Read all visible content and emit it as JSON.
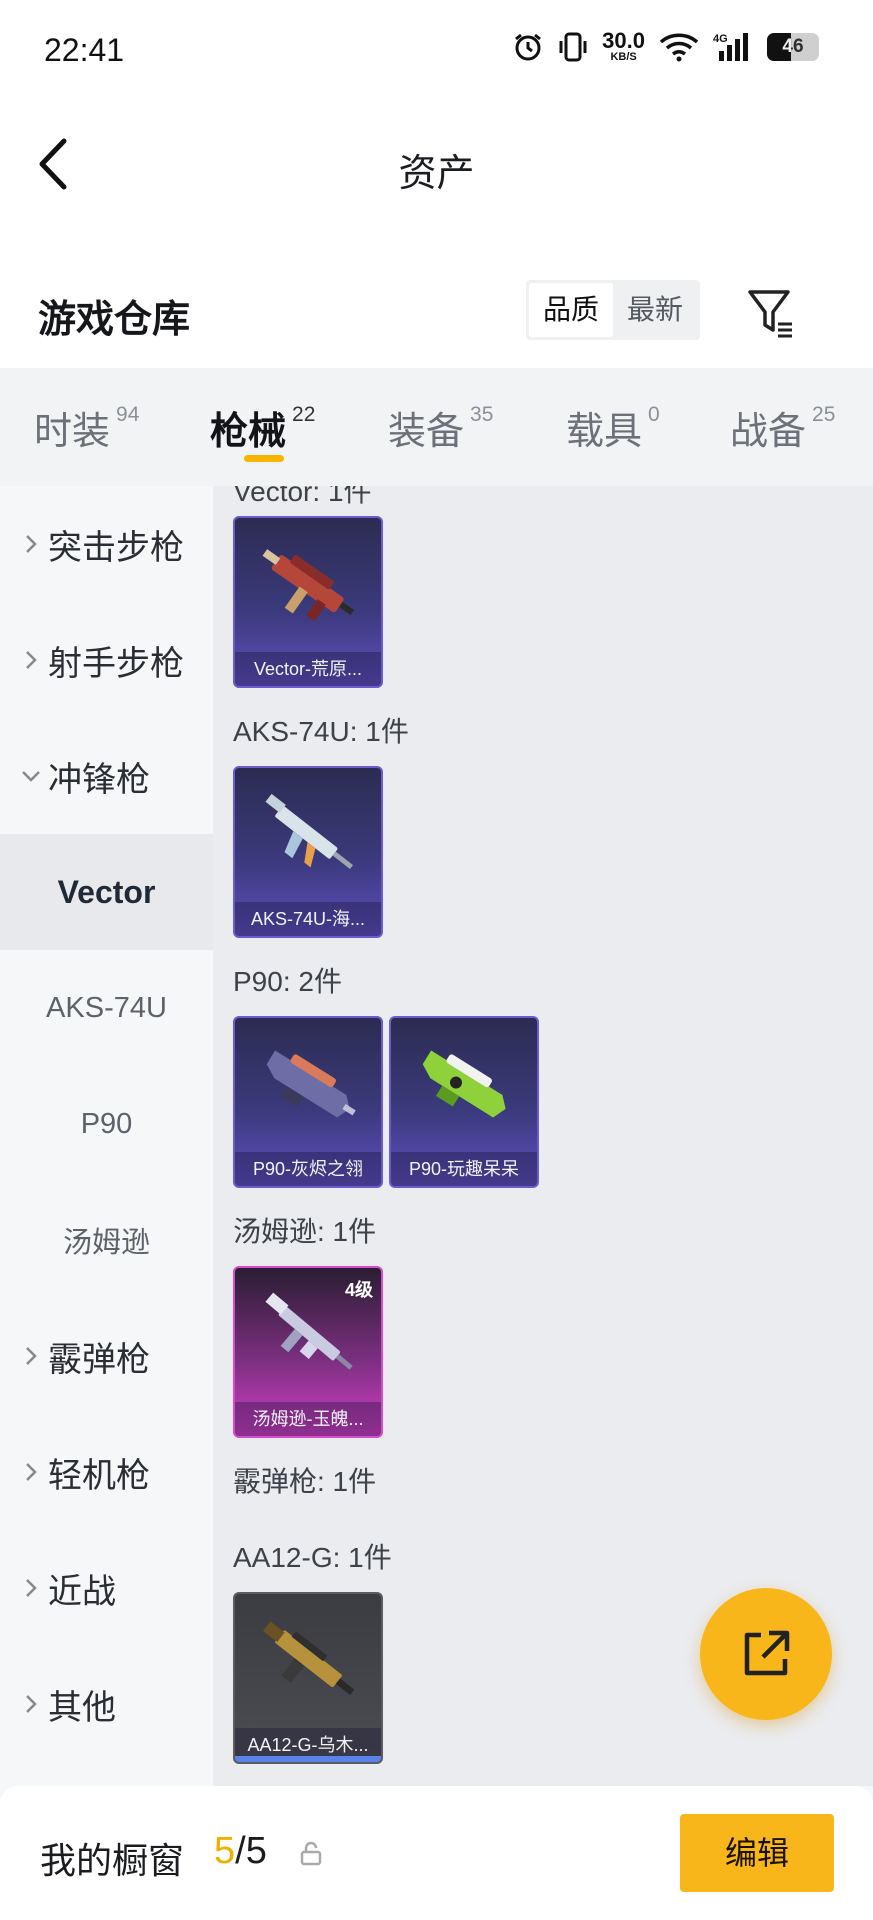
{
  "status_bar": {
    "time": "22:41",
    "net_speed_value": "30.0",
    "net_speed_unit": "KB/S",
    "network_type": "4G",
    "battery_level": "46",
    "icons": [
      "alarm-icon",
      "vibrate-icon",
      "wifi-icon",
      "signal-icon",
      "battery-icon"
    ]
  },
  "header": {
    "title": "资产"
  },
  "section": {
    "title": "游戏仓库",
    "sort_options": [
      {
        "label": "品质",
        "active": true
      },
      {
        "label": "最新",
        "active": false
      }
    ]
  },
  "tabs": [
    {
      "label": "时装",
      "count": "94"
    },
    {
      "label": "枪械",
      "count": "22",
      "active": true
    },
    {
      "label": "装备",
      "count": "35"
    },
    {
      "label": "载具",
      "count": "0"
    },
    {
      "label": "战备",
      "count": "25"
    }
  ],
  "sidebar": {
    "categories": [
      {
        "label": "突击步枪",
        "expanded": false
      },
      {
        "label": "射手步枪",
        "expanded": false
      },
      {
        "label": "冲锋枪",
        "expanded": true
      },
      {
        "label": "霰弹枪",
        "expanded": false
      },
      {
        "label": "轻机枪",
        "expanded": false
      },
      {
        "label": "近战",
        "expanded": false
      },
      {
        "label": "其他",
        "expanded": false
      }
    ],
    "subcategories": [
      {
        "label": "Vector",
        "active": true
      },
      {
        "label": "AKS-74U"
      },
      {
        "label": "P90"
      },
      {
        "label": "汤姆逊"
      }
    ]
  },
  "content": {
    "clipped_label": "Vector: 1件",
    "groups": [
      {
        "label": "AKS-74U: 1件"
      },
      {
        "label": "P90: 2件"
      },
      {
        "label": "汤姆逊: 1件"
      },
      {
        "label": "霰弹枪: 1件"
      },
      {
        "label": "AA12-G: 1件"
      }
    ],
    "items": [
      {
        "name": "Vector-荒原...",
        "rarity": "blue"
      },
      {
        "name": "AKS-74U-海...",
        "rarity": "blue"
      },
      {
        "name": "P90-灰烬之翎",
        "rarity": "blue"
      },
      {
        "name": "P90-玩趣呆呆",
        "rarity": "blue"
      },
      {
        "name": "汤姆逊-玉魄...",
        "rarity": "pink",
        "level": "4级"
      },
      {
        "name": "AA12-G-乌木...",
        "rarity": "gray"
      }
    ]
  },
  "fab": {
    "icon": "share-external-icon"
  },
  "bottom_bar": {
    "label": "我的橱窗",
    "count_current": "5",
    "count_separator": "/",
    "count_max": "5",
    "edit_label": "编辑"
  },
  "colors": {
    "accent": "#f8b61a",
    "blue_rarity": "#6c5ad0",
    "pink_rarity": "#d84ccc",
    "gray_rarity": "#5a5c62"
  }
}
